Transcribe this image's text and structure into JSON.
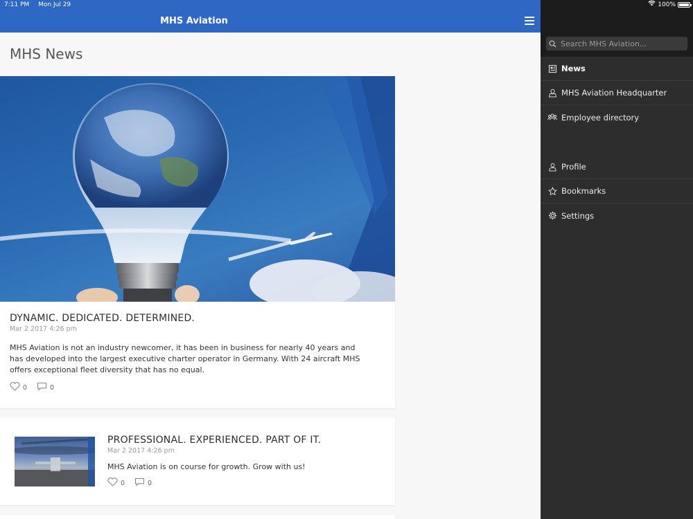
{
  "status_bar": {
    "time": "7:11 PM",
    "date": "Mon Jul 29",
    "battery": "100%"
  },
  "app": {
    "title": "MHS Aviation"
  },
  "page": {
    "title": "MHS News"
  },
  "articles": [
    {
      "title": "DYNAMIC. DEDICATED. DETERMINED.",
      "date": "Mar 2 2017 4:26 pm",
      "body": "MHS Aviation is not an industry newcomer, it has been in business for nearly 40 years and has developed into the largest executive charter operator in Germany. With 24 aircraft MHS offers exceptional fleet diversity that has no equal.",
      "likes": "0",
      "comments": "0"
    },
    {
      "title": "PROFESSIONAL. EXPERIENCED. PART OF IT.",
      "date": "Mar 2 2017 4:26 pm",
      "body": "MHS Aviation is on course for growth. Grow with us!",
      "likes": "0",
      "comments": "0"
    }
  ],
  "sidebar": {
    "search_placeholder": "Search MHS Aviation...",
    "primary_items": [
      {
        "label": "News",
        "icon": "newspaper-icon"
      },
      {
        "label": "MHS Aviation Headquarter",
        "icon": "map-pin-icon"
      },
      {
        "label": "Employee directory",
        "icon": "people-icon"
      }
    ],
    "secondary_items": [
      {
        "label": "Profile",
        "icon": "user-icon"
      },
      {
        "label": "Bookmarks",
        "icon": "star-icon"
      },
      {
        "label": "Settings",
        "icon": "gear-icon"
      }
    ]
  },
  "colors": {
    "topbar": "#2f68c4",
    "sidebar": "#2d2d2d",
    "sidebar_header": "#1c1c1c"
  }
}
